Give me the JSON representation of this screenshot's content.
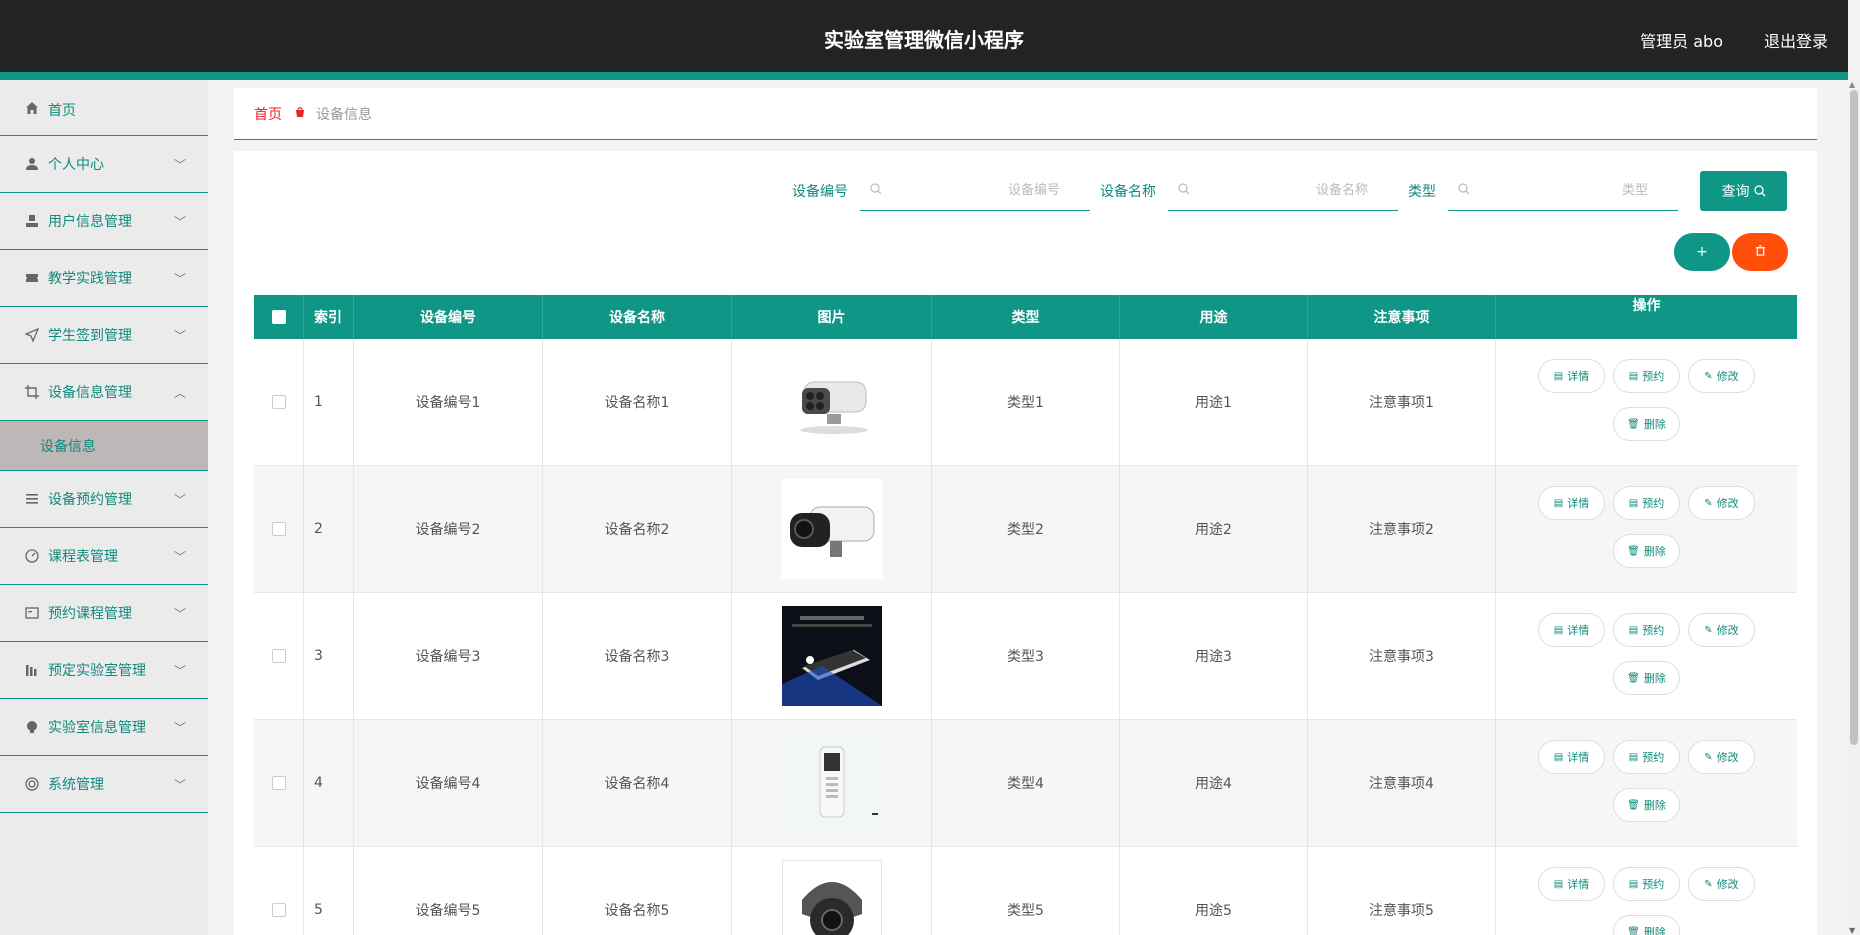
{
  "header": {
    "title": "实验室管理微信小程序",
    "user": "管理员 abo",
    "logout": "退出登录"
  },
  "sidebar": {
    "items": [
      {
        "label": "首页",
        "icon": "home-icon"
      },
      {
        "label": "个人中心",
        "icon": "person-icon"
      },
      {
        "label": "用户信息管理",
        "icon": "user-icon"
      },
      {
        "label": "教学实践管理",
        "icon": "ticket-icon"
      },
      {
        "label": "学生签到管理",
        "icon": "send-icon"
      },
      {
        "label": "设备信息管理",
        "icon": "crop-icon"
      },
      {
        "label": "设备预约管理",
        "icon": "list-icon"
      },
      {
        "label": "课程表管理",
        "icon": "gauge-icon"
      },
      {
        "label": "预约课程管理",
        "icon": "card-icon"
      },
      {
        "label": "预定实验室管理",
        "icon": "chart-icon"
      },
      {
        "label": "实验室信息管理",
        "icon": "bulb-icon"
      },
      {
        "label": "系统管理",
        "icon": "circle-icon"
      }
    ],
    "sub_item": "设备信息"
  },
  "breadcrumb": {
    "home": "首页",
    "current": "设备信息"
  },
  "search": {
    "code_label": "设备编号",
    "code_placeholder": "设备编号",
    "name_label": "设备名称",
    "name_placeholder": "设备名称",
    "type_label": "类型",
    "type_placeholder": "类型",
    "query_label": "查询"
  },
  "actions": {
    "add_label": "+",
    "delete_label": "🗑"
  },
  "table": {
    "columns": [
      "索引",
      "设备编号",
      "设备名称",
      "图片",
      "类型",
      "用途",
      "注意事项",
      "操作"
    ],
    "rows": [
      {
        "index": "1",
        "code": "设备编号1",
        "name": "设备名称1",
        "type": "类型1",
        "use": "用途1",
        "note": "注意事项1",
        "image": "bullet-camera-white"
      },
      {
        "index": "2",
        "code": "设备编号2",
        "name": "设备名称2",
        "type": "类型2",
        "use": "用途2",
        "note": "注意事项2",
        "image": "bullet-camera-black"
      },
      {
        "index": "3",
        "code": "设备编号3",
        "name": "设备名称3",
        "type": "类型3",
        "use": "用途3",
        "note": "注意事项3",
        "image": "mini-recorder"
      },
      {
        "index": "4",
        "code": "设备编号4",
        "name": "设备名称4",
        "type": "类型4",
        "use": "用途4",
        "note": "注意事项4",
        "image": "voice-recorder"
      },
      {
        "index": "5",
        "code": "设备编号5",
        "name": "设备名称5",
        "type": "类型5",
        "use": "用途5",
        "note": "注意事项5",
        "image": "dome-camera"
      }
    ],
    "ops": {
      "detail": "详情",
      "reserve": "预约",
      "edit": "修改",
      "delete": "删除"
    }
  },
  "colors": {
    "accent": "#0f9686",
    "header_bg": "#232323",
    "danger": "#ff4f0a",
    "breadcrumb_home": "#e6252f"
  }
}
